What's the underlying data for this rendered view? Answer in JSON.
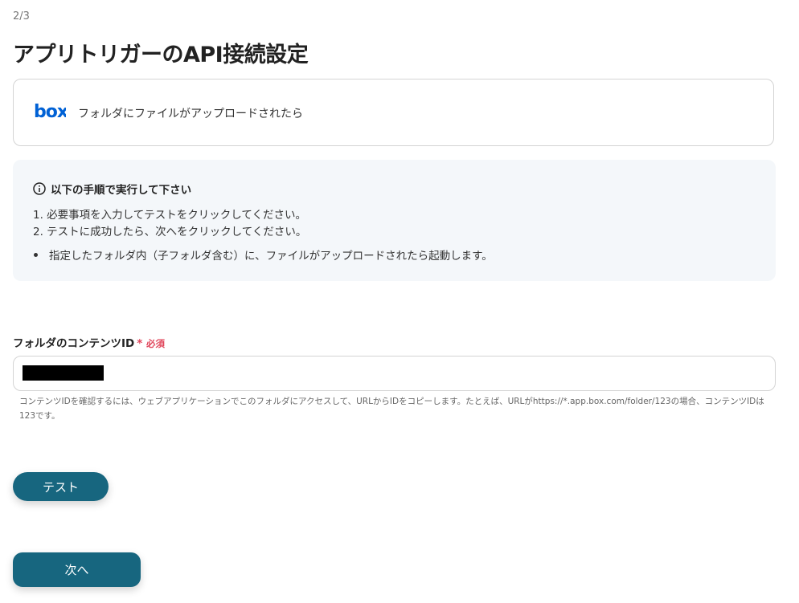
{
  "header": {
    "step": "2/3",
    "title": "アプリトリガーのAPI接続設定"
  },
  "app": {
    "logo_text": "box",
    "trigger_name": "フォルダにファイルがアップロードされたら"
  },
  "info": {
    "heading": "以下の手順で実行して下さい",
    "steps": [
      "1. 必要事項を入力してテストをクリックしてください。",
      "2. テストに成功したら、次へをクリックしてください。"
    ],
    "bullet": "指定したフォルダ内（子フォルダ含む）に、ファイルがアップロードされたら起動します。"
  },
  "field": {
    "label": "フォルダのコンテンツID",
    "required_star": "*",
    "required_text": "必須",
    "value": "",
    "help": "コンテンツIDを確認するには、ウェブアプリケーションでこのフォルダにアクセスして、URLからIDをコピーします。たとえば、URLがhttps://*.app.box.com/folder/123の場合、コンテンツIDは123です。"
  },
  "buttons": {
    "test": "テスト",
    "next": "次へ"
  },
  "colors": {
    "accent": "#17667f",
    "required": "#e0455a",
    "box_blue": "#0061d5"
  }
}
